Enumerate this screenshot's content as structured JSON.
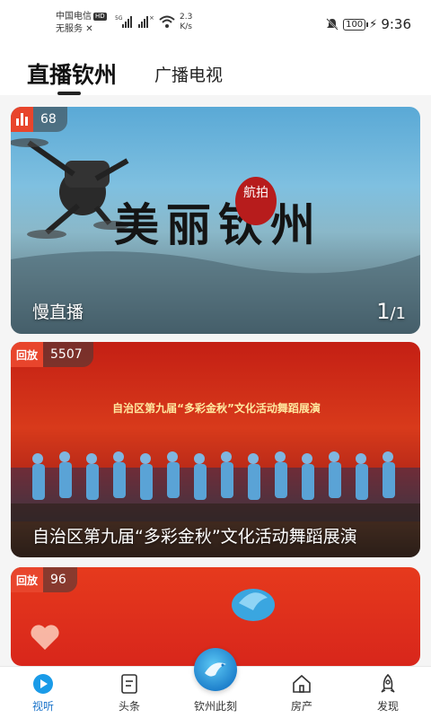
{
  "status_bar": {
    "carrier_line1": "中国电信",
    "carrier_badge": "HD",
    "carrier_line2": "无服务",
    "signal_label": "5G",
    "net_speed_value": "2.3",
    "net_speed_unit": "K/s",
    "battery": "100",
    "time": "9:36"
  },
  "top_tabs": {
    "live": "直播钦州",
    "tv": "广播电视"
  },
  "cards": [
    {
      "count": "68",
      "title": "慢直播",
      "art_text": "美丽钦州",
      "seal_text": "航拍",
      "page_current": "1",
      "page_total": "/1"
    },
    {
      "tag": "回放",
      "count": "5507",
      "title": "自治区第九届“多彩金秋”文化活动舞蹈展演",
      "stage_text": "自治区第九届“多彩金秋”文化活动舞蹈展演"
    },
    {
      "tag": "回放",
      "count": "96"
    }
  ],
  "bottom_nav": {
    "items": [
      {
        "label": "视听",
        "icon": "play-circle-icon"
      },
      {
        "label": "头条",
        "icon": "document-icon"
      },
      {
        "label": "钦州此刻",
        "icon": "globe-bird-icon"
      },
      {
        "label": "房产",
        "icon": "house-icon"
      },
      {
        "label": "发现",
        "icon": "rocket-icon"
      }
    ],
    "active_color": "#1a73c9"
  },
  "colors": {
    "tag_red": "#e8452c",
    "accent_blue": "#1a73c9"
  }
}
